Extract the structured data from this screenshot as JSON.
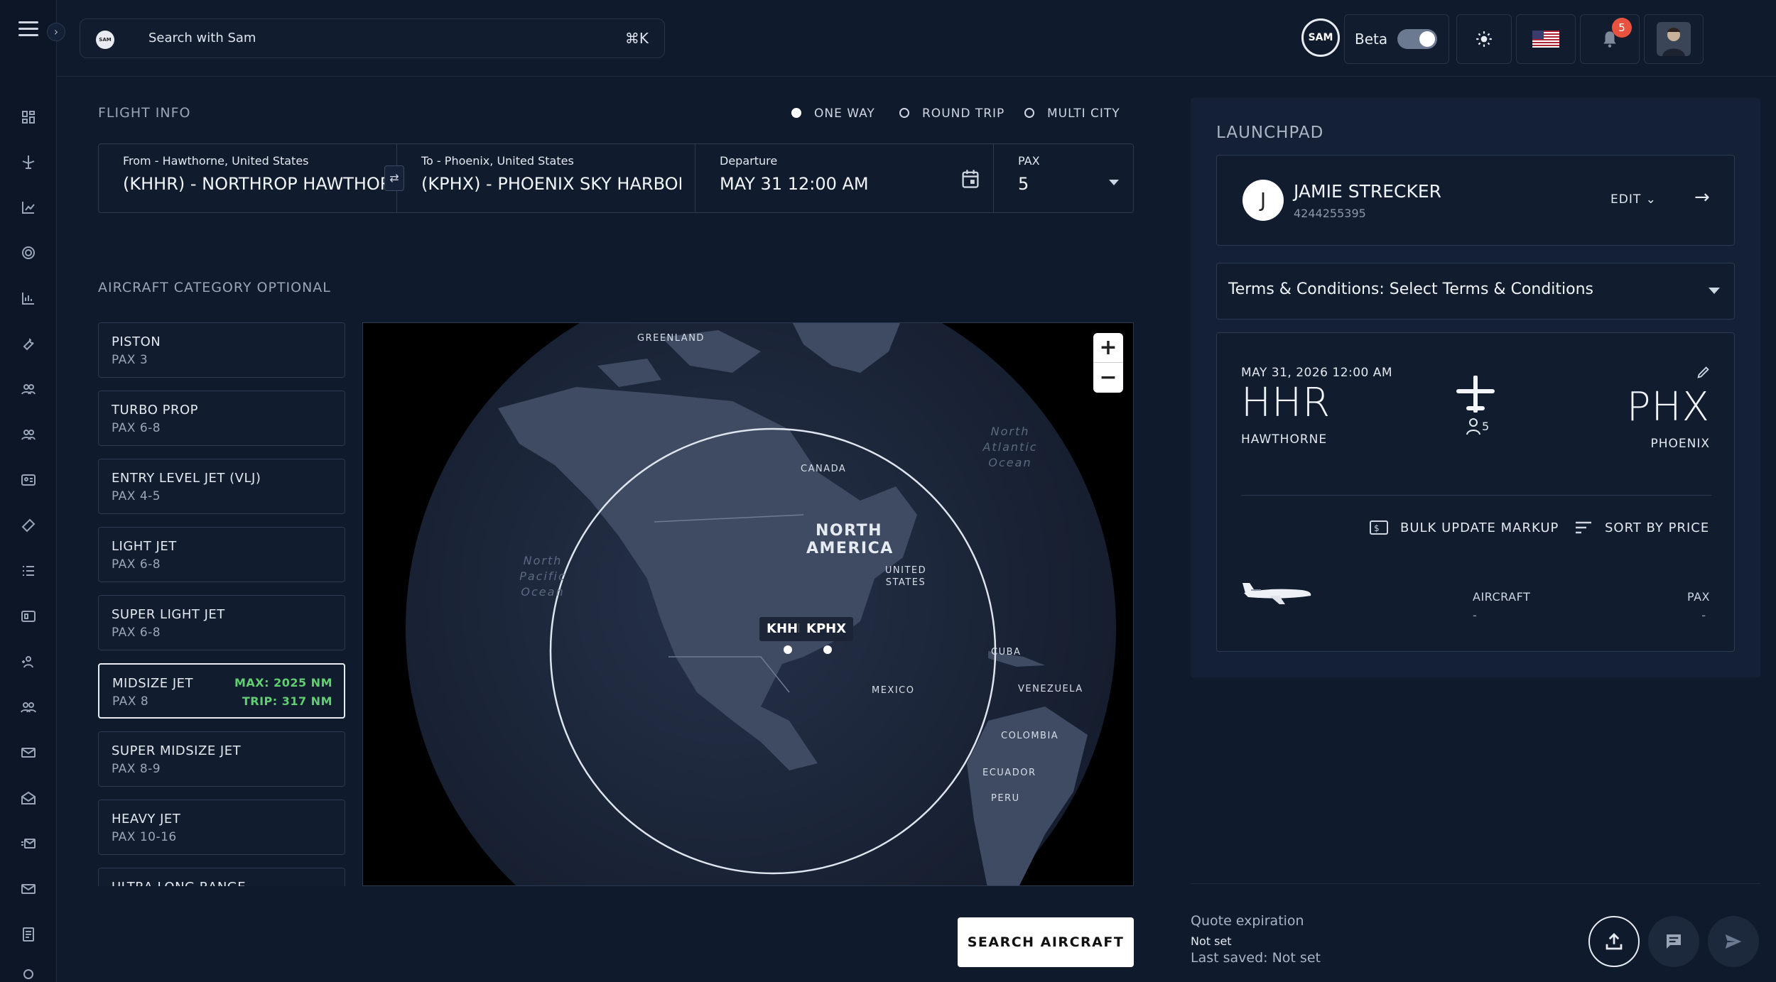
{
  "header": {
    "search_placeholder": "Search with Sam",
    "search_shortcut": "⌘K",
    "sam_logo": "SAM",
    "sam_small": "SAM",
    "beta_label": "Beta",
    "notification_count": "5"
  },
  "flight_info": {
    "title": "FLIGHT INFO",
    "trip_types": [
      "ONE WAY",
      "ROUND TRIP",
      "MULTI CITY"
    ],
    "selected_trip_type": "ONE WAY",
    "from_label": "From - Hawthorne, United States",
    "from_value": "(KHHR) - NORTHROP HAWTHORNE",
    "to_label": "To - Phoenix, United States",
    "to_value": "(KPHX) - PHOENIX SKY HARBOR INTL",
    "departure_label": "Departure",
    "departure_value": "MAY 31 12:00 AM",
    "pax_label": "PAX",
    "pax_value": "5"
  },
  "aircraft": {
    "title": "AIRCRAFT CATEGORY OPTIONAL",
    "categories": [
      {
        "name": "PISTON",
        "pax": "PAX 3"
      },
      {
        "name": "TURBO PROP",
        "pax": "PAX 6-8"
      },
      {
        "name": "ENTRY LEVEL JET (VLJ)",
        "pax": "PAX 4-5"
      },
      {
        "name": "LIGHT JET",
        "pax": "PAX 6-8"
      },
      {
        "name": "SUPER LIGHT JET",
        "pax": "PAX 6-8"
      },
      {
        "name": "MIDSIZE JET",
        "pax": "PAX 8",
        "max": "MAX: 2025 NM",
        "trip": "TRIP: 317 NM"
      },
      {
        "name": "SUPER MIDSIZE JET",
        "pax": "PAX 8-9"
      },
      {
        "name": "HEAVY JET",
        "pax": "PAX 10-16"
      },
      {
        "name": "ULTRA LONG RANGE",
        "pax": ""
      }
    ],
    "selected": "MIDSIZE JET"
  },
  "map": {
    "labels": {
      "greenland": "GREENLAND",
      "canada": "CANADA",
      "north_america": "NORTH AMERICA",
      "united_states": "UNITED STATES",
      "mexico": "MEXICO",
      "cuba": "CUBA",
      "venezuela": "VENEZUELA",
      "colombia": "COLOMBIA",
      "ecuador": "ECUADOR",
      "peru": "PERU",
      "north_atlantic": "North Atlantic Ocean",
      "north_pacific": "North Pacific Ocean"
    },
    "origin_code": "KHHR",
    "dest_code": "KPHX"
  },
  "search_button": "SEARCH AIRCRAFT",
  "launchpad": {
    "title": "LAUNCHPAD",
    "client": {
      "initial": "J",
      "name": "JAMIE STRECKER",
      "phone": "4244255395",
      "edit_label": "EDIT"
    },
    "terms": "Terms & Conditions: Select Terms & Conditions",
    "trip": {
      "date": "MAY 31, 2026 12:00 AM",
      "from_code": "HHR",
      "from_city": "HAWTHORNE",
      "to_code": "PHX",
      "to_city": "PHOENIX",
      "pax": "5",
      "bulk_update": "BULK UPDATE MARKUP",
      "sort": "SORT BY PRICE",
      "col_aircraft": "AIRCRAFT",
      "col_pax": "PAX",
      "aircraft_value": "-",
      "pax_value": "-"
    }
  },
  "footer": {
    "quote_expiration": "Quote expiration",
    "not_set": "Not set",
    "last_saved": "Last saved: Not set"
  }
}
